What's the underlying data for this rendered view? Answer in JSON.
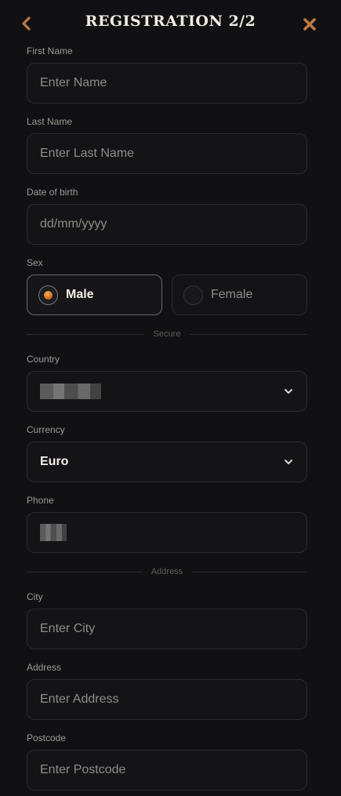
{
  "header": {
    "title": "REGISTRATION 2/2",
    "back_icon": "chevron-left-icon",
    "close_icon": "close-icon",
    "accent_color": "#c07a45"
  },
  "form": {
    "first_name": {
      "label": "First Name",
      "placeholder": "Enter Name"
    },
    "last_name": {
      "label": "Last Name",
      "placeholder": "Enter Last Name"
    },
    "date_of_birth": {
      "label": "Date of birth",
      "placeholder": "dd/mm/yyyy"
    },
    "sex": {
      "label": "Sex",
      "options": [
        {
          "label": "Male",
          "selected": true
        },
        {
          "label": "Female",
          "selected": false
        }
      ]
    },
    "secure_divider": "Secure",
    "country": {
      "label": "Country",
      "value": ""
    },
    "currency": {
      "label": "Currency",
      "value": "Euro"
    },
    "phone": {
      "label": "Phone",
      "value": ""
    },
    "address_divider": "Address",
    "city": {
      "label": "City",
      "placeholder": "Enter City"
    },
    "address": {
      "label": "Address",
      "placeholder": "Enter Address"
    },
    "postcode": {
      "label": "Postcode",
      "placeholder": "Enter Postcode"
    }
  }
}
